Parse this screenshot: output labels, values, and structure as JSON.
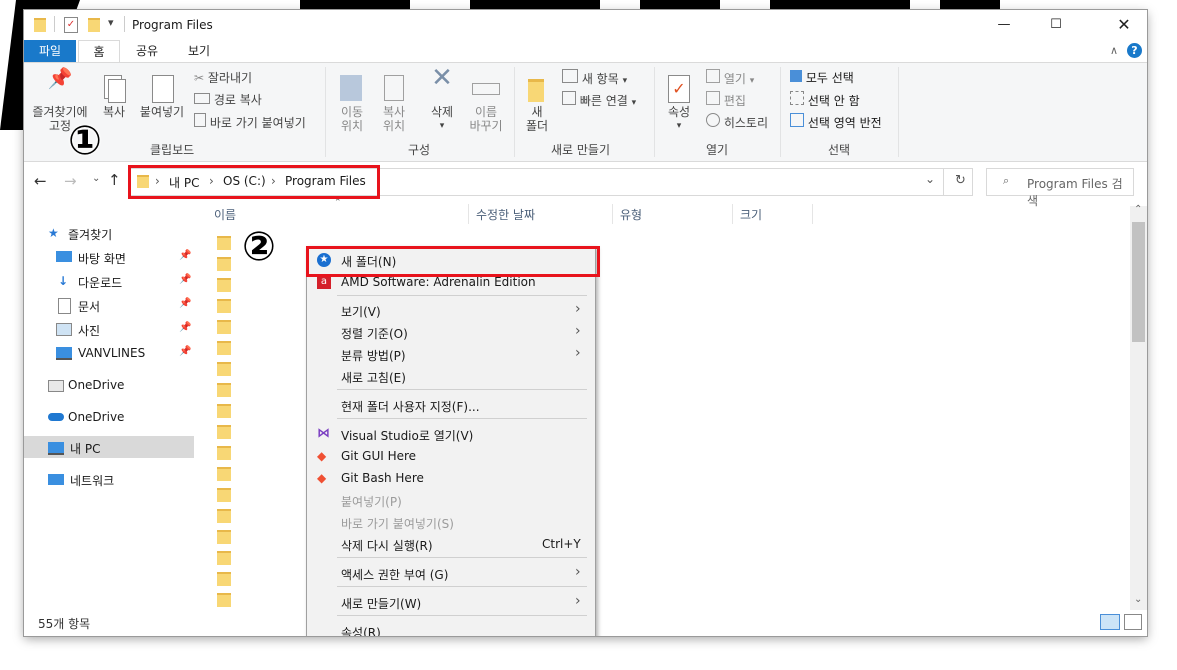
{
  "window": {
    "title": "Program Files"
  },
  "ribbon_tabs": [
    "파일",
    "홈",
    "공유",
    "보기"
  ],
  "ribbon": {
    "clipboard": {
      "pin": "즐겨찾기에\n고정",
      "copy": "복사",
      "paste": "붙여넣기",
      "cut": "잘라내기",
      "copy_path": "경로 복사",
      "paste_shortcut": "바로 가기 붙여넣기",
      "label": "클립보드"
    },
    "organize": {
      "move": "이동\n위치",
      "copy_to": "복사\n위치",
      "delete": "삭제",
      "rename": "이름\n바꾸기",
      "label": "구성"
    },
    "new": {
      "new_folder": "새\n폴더",
      "new_item": "새 항목",
      "easy_access": "빠른 연결",
      "label": "새로 만들기"
    },
    "open": {
      "properties": "속성",
      "open": "열기",
      "edit": "편집",
      "history": "히스토리",
      "label": "열기"
    },
    "select": {
      "select_all": "모두 선택",
      "select_none": "선택 안 함",
      "invert": "선택 영역 반전",
      "label": "선택"
    }
  },
  "address": {
    "crumbs": [
      "내 PC",
      "OS (C:)",
      "Program Files"
    ],
    "search_placeholder": "Program Files 검색"
  },
  "nav": {
    "quick_access": "즐겨찾기",
    "items": [
      "바탕 화면",
      "다운로드",
      "문서",
      "사진",
      "VANVLINES"
    ],
    "onedrive1": "OneDrive",
    "onedrive2": "OneDrive",
    "this_pc": "내 PC",
    "network": "네트워크"
  },
  "columns": [
    "이름",
    "수정한 날짜",
    "유형",
    "크기"
  ],
  "status": {
    "count": "55개 항목"
  },
  "context_menu": {
    "new_folder": "새 폴더(N)",
    "amd": "AMD Software: Adrenalin Edition",
    "view": "보기(V)",
    "sort": "정렬 기준(O)",
    "group": "분류 방법(P)",
    "refresh": "새로 고침(E)",
    "customize": "현재 폴더 사용자 지정(F)...",
    "vs": "Visual Studio로 열기(V)",
    "git_gui": "Git GUI Here",
    "git_bash": "Git Bash Here",
    "paste": "붙여넣기(P)",
    "paste_shortcut": "바로 가기 붙여넣기(S)",
    "undo_delete": "삭제 다시 실행(R)",
    "undo_shortcut": "Ctrl+Y",
    "access": "액세스 권한 부여 (G)",
    "new": "새로 만들기(W)",
    "properties": "속성(R)"
  },
  "annotations": {
    "one": "①",
    "two": "②"
  },
  "colors": {
    "accent": "#1979ca",
    "highlight_box": "#e8131c"
  }
}
